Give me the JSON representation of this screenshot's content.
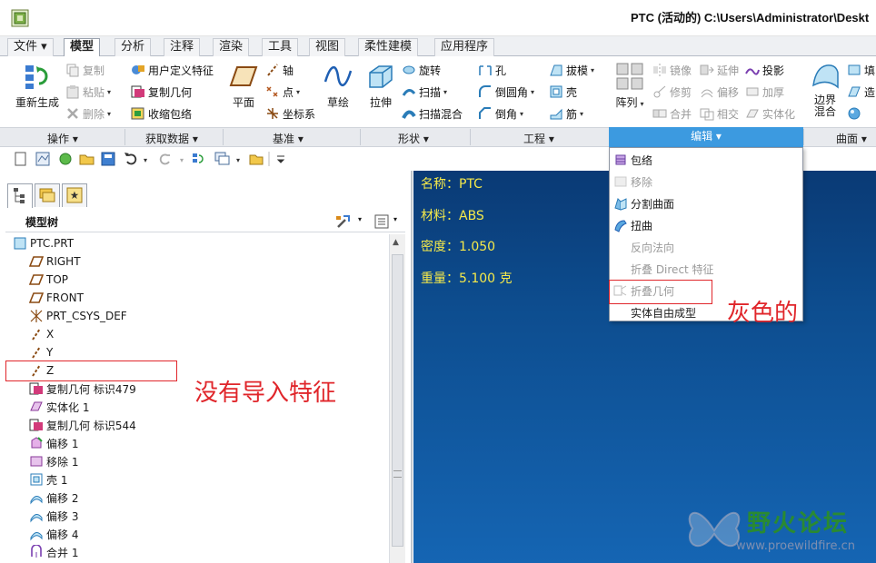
{
  "window": {
    "title": "PTC (活动的) C:\\Users\\Administrator\\Deskt"
  },
  "tabs": [
    {
      "label": "文件 ▾"
    },
    {
      "label": "模型"
    },
    {
      "label": "分析"
    },
    {
      "label": "注释"
    },
    {
      "label": "渲染"
    },
    {
      "label": "工具"
    },
    {
      "label": "视图"
    },
    {
      "label": "柔性建模"
    },
    {
      "label": "应用程序"
    }
  ],
  "ribbon": {
    "regen": "重新生成",
    "copy": "复制",
    "paste": "粘贴",
    "delete": "删除",
    "udf": "用户定义特征",
    "copy_geom": "复制几何",
    "shrinkwrap": "收缩包络",
    "plane": "平面",
    "axis": "轴",
    "point": "点",
    "csys": "坐标系",
    "sketch": "草绘",
    "extrude": "拉伸",
    "revolve": "旋转",
    "sweep": "扫描",
    "swept_blend": "扫描混合",
    "hole": "孔",
    "round": "倒圆角",
    "chamfer": "倒角",
    "draft": "拔模",
    "shell": "壳",
    "rib": "筋",
    "pattern": "阵列",
    "mirror": "镜像",
    "trim": "修剪",
    "merge": "合并",
    "extend": "延伸",
    "offset": "偏移",
    "intersect": "相交",
    "project": "投影",
    "thicken": "加厚",
    "solidify": "实体化",
    "boundary_blend": "边界混合",
    "fill": "填",
    "style": "造"
  },
  "groups": {
    "operations": "操作 ▾",
    "get_data": "获取数据 ▾",
    "datum": "基准 ▾",
    "shapes": "形状 ▾",
    "engineering": "工程 ▾",
    "editing": "编辑 ▾",
    "surfaces": "曲面 ▾"
  },
  "model_tree": {
    "title": "模型树",
    "items": [
      {
        "label": "PTC.PRT",
        "icon": "part-icon"
      },
      {
        "label": "RIGHT",
        "icon": "datum-plane-icon"
      },
      {
        "label": "TOP",
        "icon": "datum-plane-icon"
      },
      {
        "label": "FRONT",
        "icon": "datum-plane-icon"
      },
      {
        "label": "PRT_CSYS_DEF",
        "icon": "csys-icon"
      },
      {
        "label": "X",
        "icon": "axis-icon"
      },
      {
        "label": "Y",
        "icon": "axis-icon"
      },
      {
        "label": "Z",
        "icon": "axis-icon"
      },
      {
        "label": "复制几何 标识479",
        "icon": "copy-geometry-icon"
      },
      {
        "label": "实体化 1",
        "icon": "solidify-icon"
      },
      {
        "label": "复制几何 标识544",
        "icon": "copy-geometry-icon"
      },
      {
        "label": "偏移 1",
        "icon": "offset-icon"
      },
      {
        "label": "移除 1",
        "icon": "remove-icon"
      },
      {
        "label": "壳 1",
        "icon": "shell-icon"
      },
      {
        "label": "偏移 2",
        "icon": "offset-surface-icon"
      },
      {
        "label": "偏移 3",
        "icon": "offset-surface-icon"
      },
      {
        "label": "偏移 4",
        "icon": "offset-surface-icon"
      },
      {
        "label": "合并 1",
        "icon": "merge-icon"
      }
    ]
  },
  "viewport": {
    "name": "名称：PTC",
    "material": "材料：ABS",
    "density": "密度：1.050",
    "weight": "重量：5.100 克"
  },
  "edit_menu": {
    "items": [
      {
        "label": "包络",
        "enabled": true
      },
      {
        "label": "移除",
        "enabled": false
      },
      {
        "label": "分割曲面",
        "enabled": true
      },
      {
        "label": "扭曲",
        "enabled": true
      },
      {
        "label": "反向法向",
        "enabled": false
      },
      {
        "label": "折叠 Direct 特征",
        "enabled": false
      },
      {
        "label": "折叠几何",
        "enabled": false
      },
      {
        "label": "实体自由成型",
        "enabled": true
      }
    ]
  },
  "annotations": {
    "no_import": "没有导入特征",
    "grayed": "灰色的"
  },
  "watermark": {
    "title": "野火论坛",
    "url": "www.proewildfire.cn"
  },
  "colors": {
    "accent": "#3c9ae0",
    "annotation": "#e0262b",
    "info_text": "#f5e94a"
  }
}
